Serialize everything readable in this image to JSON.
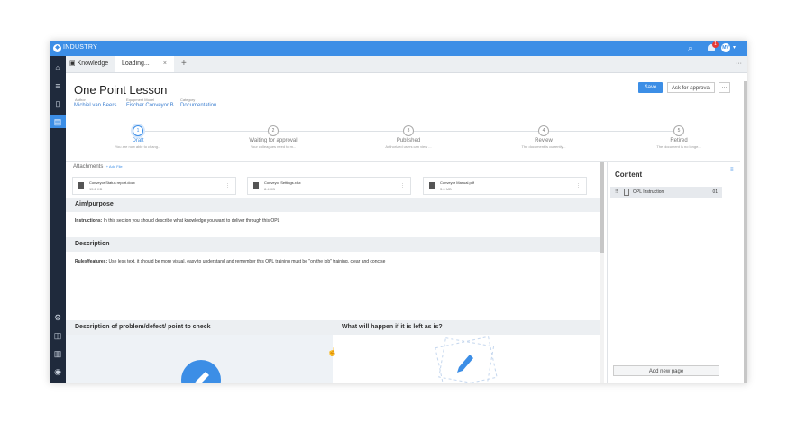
{
  "app": {
    "name": "INDUSTRY",
    "notification_count": "1",
    "avatar_initials": "MV"
  },
  "tabs": [
    {
      "label": "Knowledge"
    },
    {
      "label": "Loading..."
    }
  ],
  "page": {
    "title": "One Point Lesson",
    "author_label": "Author",
    "author": "Michiel van Beers",
    "model_label": "Equipment Model",
    "model": "Fischer Conveyor B...",
    "category_label": "Category",
    "category": "Documentation",
    "save": "Save",
    "approve": "Ask for approval",
    "more": "···"
  },
  "steps": [
    {
      "num": "1",
      "name": "Draft",
      "desc": "You are now able to chang..."
    },
    {
      "num": "2",
      "name": "Waiting for approval",
      "desc": "Your colleagues need to m..."
    },
    {
      "num": "3",
      "name": "Published",
      "desc": "Authorized users can view ..."
    },
    {
      "num": "4",
      "name": "Review",
      "desc": "The document is currently..."
    },
    {
      "num": "5",
      "name": "Retired",
      "desc": "The document is no longe..."
    }
  ],
  "attachments": {
    "label": "Attachments",
    "add": "+ Add File",
    "files": [
      {
        "name": "Conveyor Status report.docx",
        "size": "15.2 KB"
      },
      {
        "name": "Conveyor Settings.xlsx",
        "size": "8.4 KB"
      },
      {
        "name": "Conveyor Manual.pdf",
        "size": "3.0 MB"
      }
    ]
  },
  "sections": {
    "aim_title": "Aim/purpose",
    "aim_lead": "Instructions:",
    "aim_text": "In this section you should describe what knowledge you want to deliver through this OPL",
    "desc_title": "Description",
    "desc_lead": "Rules/features:",
    "desc_text": "Use less text, it should be more visual, easy to understand and remember this OPL training must be \"on the job\" training, clear and concise",
    "problem_title": "Description of problem/defect/ point to check",
    "left_title": "What will happen if it is left as is?"
  },
  "content_panel": {
    "title": "Content",
    "item_label": "OPL Instruction",
    "item_number": "01",
    "add_page": "Add new page"
  },
  "colors": {
    "accent": "#3c8ee6",
    "nav": "#1f2a3c"
  },
  "icons": [
    "search-icon",
    "bell-icon",
    "home-icon",
    "list-icon",
    "book-icon",
    "document-icon",
    "settings-icon",
    "chart-icon",
    "edit-icon"
  ]
}
